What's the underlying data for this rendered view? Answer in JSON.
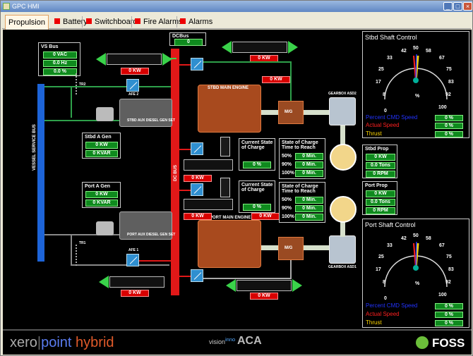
{
  "window": {
    "title": "GPC HMI"
  },
  "tabs": [
    "Propulsion",
    "Battery",
    "Switchboard",
    "Fire Alarms",
    "Alarms"
  ],
  "vs_bus": {
    "title": "VS Bus",
    "v1": "0 VAC",
    "v2": "0.0 Hz",
    "v3": "0.0 %"
  },
  "dc_bus": {
    "title": "DCBus",
    "value": "0"
  },
  "dc_bus_label": "DC BUS",
  "vessel_bus_label": "VESSEL SERVICE BUS",
  "stbd_gen": {
    "title": "Stbd A Gen",
    "kw": "0 KW",
    "kvar": "0 KVAR",
    "caption": "STBD AUX DIESEL GEN SET"
  },
  "port_gen": {
    "title": "Port A Gen",
    "kw": "0 KW",
    "kvar": "0 KVAR",
    "caption": "PORT AUX DIESEL GEN SET"
  },
  "afe2": "AFE 2",
  "afe1": "AFE 1",
  "tr2": "TR2",
  "tr1": "TR1",
  "kw_displays": {
    "top_left": "0 KW",
    "top_right": "0 KW",
    "stbd_engine": "0 KW",
    "batt1": "0 KW",
    "batt2": "0 KW",
    "port_engine": "0 KW",
    "bottom_left": "0 KW",
    "bottom_right": "0 KW"
  },
  "stbd_engine_label": "STBD MAIN ENGINE",
  "port_engine_label": "PORT MAIN ENGINE",
  "mg_label": "M/G",
  "gearbox_stbd": "GEARBOX ASD2",
  "gearbox_port": "GEARBOX ASD1",
  "charge1": {
    "title": "Current State of Charge",
    "value": "0 %"
  },
  "charge2": {
    "title": "Current State of Charge",
    "value": "0 %"
  },
  "soc1": {
    "title": "State of Charge Time to Reach",
    "rows": [
      {
        "p": "50%",
        "v": "0 Min."
      },
      {
        "p": "90%",
        "v": "0 Min."
      },
      {
        "p": "100%",
        "v": "0 Min."
      }
    ]
  },
  "soc2": {
    "title": "State of Charge Time to Reach",
    "rows": [
      {
        "p": "50%",
        "v": "0 Min."
      },
      {
        "p": "90%",
        "v": "0 Min."
      },
      {
        "p": "100%",
        "v": "0 Min."
      }
    ]
  },
  "stbd_shaft": {
    "title": "Stbd Shaft Control",
    "ticks": [
      "0",
      "8",
      "17",
      "25",
      "33",
      "42",
      "50",
      "58",
      "67",
      "75",
      "83",
      "92",
      "100"
    ],
    "unit": "%",
    "cmd_label": "Percent CMD Speed",
    "cmd": "0 %",
    "actual_label": "Actual Speed",
    "actual": "0 %",
    "thrust_label": "Thrust",
    "thrust": "0 %"
  },
  "port_shaft": {
    "title": "Port Shaft Control",
    "ticks": [
      "0",
      "8",
      "17",
      "25",
      "33",
      "42",
      "50",
      "58",
      "67",
      "75",
      "83",
      "92",
      "100"
    ],
    "unit": "%",
    "cmd_label": "Percent CMD Speed",
    "cmd": "0 %",
    "actual_label": "Actual Speed",
    "actual": "0 %",
    "thrust_label": "Thrust",
    "thrust": "0 %"
  },
  "stbd_prop": {
    "title": "Stbd Prop",
    "kw": "0 KW",
    "tons": "0.0 Tons",
    "rpm": "0 RPM"
  },
  "port_prop": {
    "title": "Port Prop",
    "kw": "0 KW",
    "tons": "0.0 Tons",
    "rpm": "0 RPM"
  },
  "footer": {
    "brand_left_1": "xero",
    "brand_left_2": "point",
    "brand_left_3": "hybrid",
    "brand_mid": "ACA",
    "brand_mid_small": "inno",
    "brand_mid_small2": "vision",
    "brand_right": "FOSS"
  },
  "colors": {
    "green": "#0f8a1e",
    "red": "#d80000",
    "blue_bus": "#1d64d8",
    "dc_bus": "#e11818",
    "cmd": "#2233ff",
    "actual": "#ff2020",
    "thrust": "#ffd700"
  }
}
